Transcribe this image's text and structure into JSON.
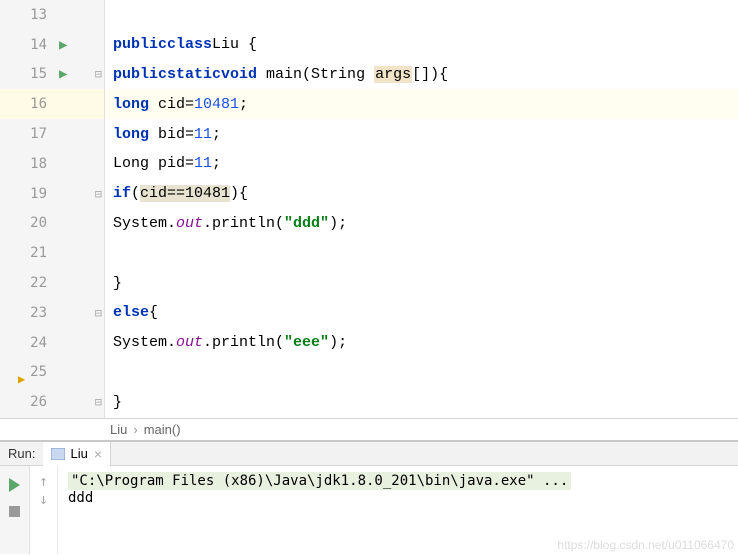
{
  "lines": {
    "n13": "13",
    "n14": "14",
    "n15": "15",
    "n16": "16",
    "n17": "17",
    "n18": "18",
    "n19": "19",
    "n20": "20",
    "n21": "21",
    "n22": "22",
    "n23": "23",
    "n24": "24",
    "n25": "25",
    "n26": "26"
  },
  "code": {
    "l14_kw1": "public",
    "l14_kw2": "class",
    "l14_name": "Liu",
    "l14_brace": " {",
    "l15_kw1": "public",
    "l15_kw2": "static",
    "l15_kw3": "void",
    "l15_main": " main(String ",
    "l15_args": "args",
    "l15_end": "[]){",
    "l16_kw": "long",
    "l16_var": " cid=",
    "l16_num": "10481",
    "l16_end": ";",
    "l17_kw": "long",
    "l17_var": " bid=",
    "l17_num": "11",
    "l17_end": ";",
    "l18_type": "Long",
    "l18_var": " pid=",
    "l18_num": "11",
    "l18_end": ";",
    "l19_kw": "if",
    "l19_open": "(",
    "l19_cond": "cid==10481",
    "l19_close": "){",
    "l20_sys": "System.",
    "l20_out": "out",
    "l20_call": ".println(",
    "l20_str": "\"ddd\"",
    "l20_end": ");",
    "l22_brace": "}",
    "l23_kw": "else",
    "l23_brace": "{",
    "l24_sys": "System.",
    "l24_out": "out",
    "l24_call": ".println(",
    "l24_str": "\"eee\"",
    "l24_end": ");",
    "l26_brace": "}"
  },
  "breadcrumb": {
    "cls": "Liu",
    "sep": "›",
    "method": "main()"
  },
  "run": {
    "label": "Run:",
    "tab": "Liu",
    "cmd": "\"C:\\Program Files (x86)\\Java\\jdk1.8.0_201\\bin\\java.exe\" ...",
    "output": "ddd"
  },
  "watermark": "https://blog.csdn.net/u011066470"
}
